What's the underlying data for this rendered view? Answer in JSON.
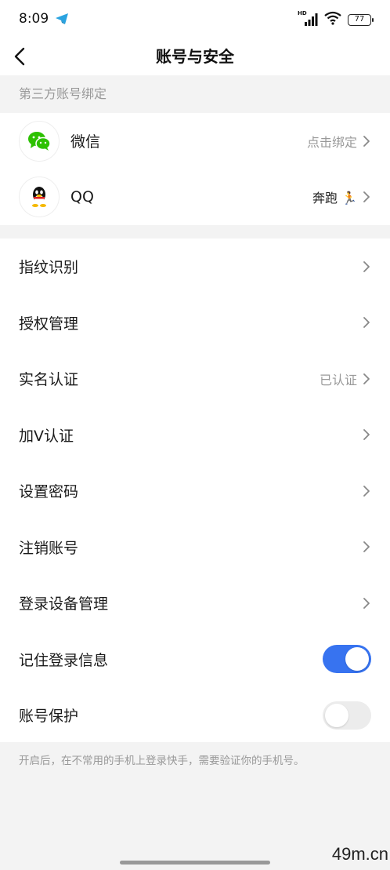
{
  "status": {
    "time": "8:09",
    "hd": "HD",
    "battery": "77"
  },
  "nav": {
    "title": "账号与安全"
  },
  "third_party": {
    "section_label": "第三方账号绑定",
    "items": [
      {
        "label": "微信",
        "value": "点击绑定",
        "icon": "wechat-icon"
      },
      {
        "label": "QQ",
        "value": "奔跑 🏃",
        "icon": "qq-icon"
      }
    ]
  },
  "security": {
    "items": [
      {
        "label": "指纹识别",
        "value": ""
      },
      {
        "label": "授权管理",
        "value": ""
      },
      {
        "label": "实名认证",
        "value": "已认证"
      },
      {
        "label": "加V认证",
        "value": ""
      },
      {
        "label": "设置密码",
        "value": ""
      },
      {
        "label": "注销账号",
        "value": ""
      },
      {
        "label": "登录设备管理",
        "value": ""
      }
    ],
    "toggles": [
      {
        "label": "记住登录信息",
        "on": true
      },
      {
        "label": "账号保护",
        "on": false
      }
    ]
  },
  "footnote": "开启后，在不常用的手机上登录快手，需要验证你的手机号。",
  "watermark": "49m.cn",
  "colors": {
    "accent": "#3773f0",
    "wechat": "#2dc100",
    "background": "#f3f3f3"
  }
}
